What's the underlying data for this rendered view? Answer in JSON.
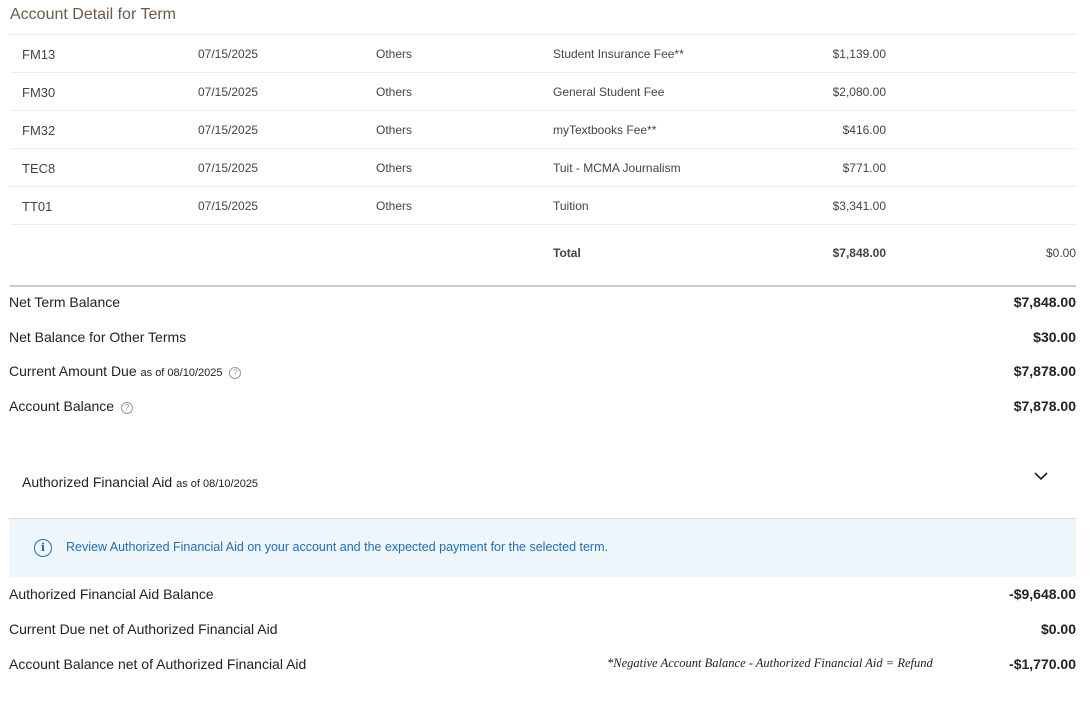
{
  "section_title": "Account Detail for Term",
  "rows": [
    {
      "code": "FM13",
      "date": "07/15/2025",
      "type": "Others",
      "description": "Student Insurance Fee**",
      "amount": "$1,139.00"
    },
    {
      "code": "FM30",
      "date": "07/15/2025",
      "type": "Others",
      "description": "General Student Fee",
      "amount": "$2,080.00"
    },
    {
      "code": "FM32",
      "date": "07/15/2025",
      "type": "Others",
      "description": "myTextbooks Fee**",
      "amount": "$416.00"
    },
    {
      "code": "TEC8",
      "date": "07/15/2025",
      "type": "Others",
      "description": "Tuit - MCMA Journalism",
      "amount": "$771.00"
    },
    {
      "code": "TT01",
      "date": "07/15/2025",
      "type": "Others",
      "description": "Tuition",
      "amount": "$3,341.00"
    }
  ],
  "total": {
    "label": "Total",
    "amount": "$7,848.00",
    "paid": "$0.00"
  },
  "summary": {
    "net_term_balance": {
      "label": "Net Term Balance",
      "value": "$7,848.00"
    },
    "net_other_terms": {
      "label": "Net Balance for Other Terms",
      "value": "$30.00"
    },
    "current_due": {
      "label": "Current Amount Due",
      "as_of": "as of 08/10/2025",
      "value": "$7,878.00"
    },
    "account_balance": {
      "label": "Account Balance",
      "value": "$7,878.00"
    }
  },
  "aid": {
    "header_label": "Authorized Financial Aid",
    "header_as_of": "as of 08/10/2025",
    "info_text": "Review Authorized Financial Aid on your account and the expected payment for the selected term.",
    "aid_balance": {
      "label": "Authorized Financial Aid Balance",
      "value": "-$9,648.00"
    },
    "current_due_net": {
      "label": "Current Due net of Authorized Financial Aid",
      "value": "$0.00"
    },
    "account_balance_net": {
      "label": "Account Balance net of Authorized Financial Aid",
      "value": "-$1,770.00"
    },
    "note": "*Negative Account Balance - Authorized Financial Aid = Refund"
  },
  "icons": {
    "help": "question-circle-icon",
    "info": "info-circle-icon",
    "chevron": "chevron-down-icon"
  },
  "colors": {
    "info_text": "#1f6fb5",
    "info_bg": "#eef6fc",
    "title": "#6b5a4a"
  }
}
